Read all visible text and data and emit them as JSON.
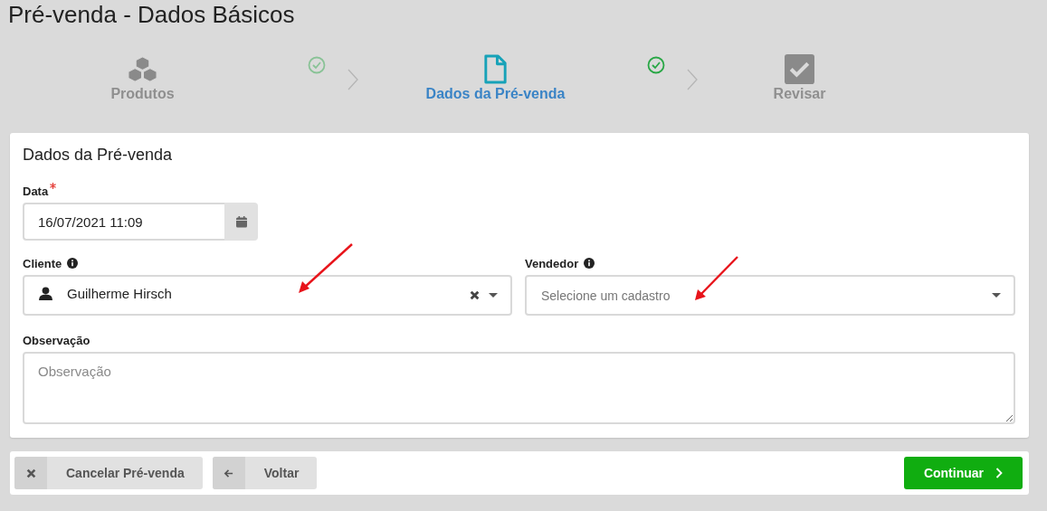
{
  "page_title": "Pré-venda - Dados Básicos",
  "steps": [
    {
      "label": "Produtos",
      "kind": "products",
      "selected": false,
      "complete": true
    },
    {
      "label": "Dados da Pré-venda",
      "kind": "details",
      "selected": true,
      "complete": true
    },
    {
      "label": "Revisar",
      "kind": "review",
      "selected": false,
      "complete": false
    }
  ],
  "form": {
    "title": "Dados da Pré-venda",
    "date": {
      "label": "Data",
      "required": true,
      "value": "16/07/2021 11:09"
    },
    "cliente": {
      "label": "Cliente",
      "value": "Guilherme Hirsch"
    },
    "vendedor": {
      "label": "Vendedor",
      "placeholder": "Selecione um cadastro"
    },
    "observacao": {
      "label": "Observação",
      "placeholder": "Observação"
    }
  },
  "footer": {
    "buttons": [
      {
        "label": "Cancelar Pré-venda",
        "kind": "cancel"
      },
      {
        "label": "Voltar",
        "kind": "back"
      },
      {
        "label": "Continuar",
        "kind": "continue"
      }
    ]
  }
}
